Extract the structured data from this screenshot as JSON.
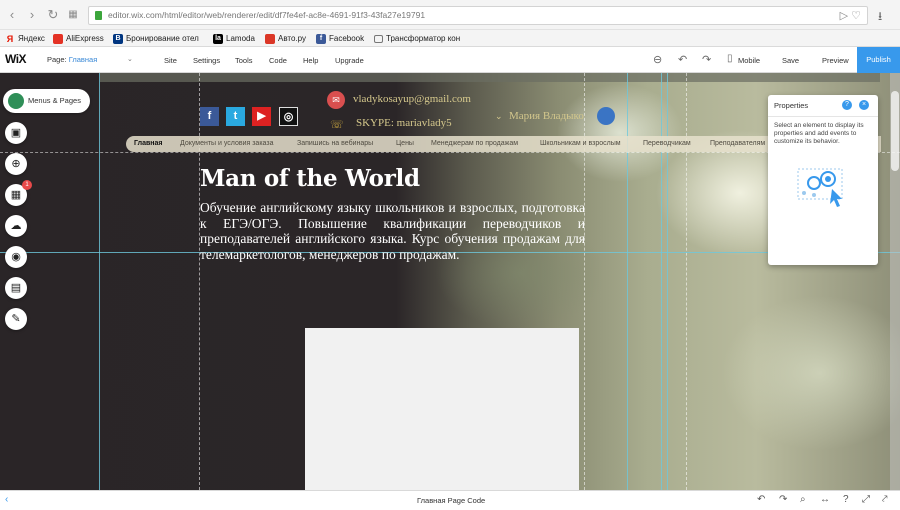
{
  "browser": {
    "url": "editor.wix.com/html/editor/web/renderer/edit/df7fe4ef-ac8e-4691-91f3-43fa27e19791",
    "bookmarks": [
      {
        "label": "Яндекс",
        "icon": "yandex-icon",
        "color": "#e61400"
      },
      {
        "label": "AliExpress",
        "icon": "aliexpress-icon",
        "color": "#e43225"
      },
      {
        "label": "Бронирование отел",
        "icon": "booking-icon",
        "color": "#003580"
      },
      {
        "label": "Lamoda",
        "icon": "lamoda-icon",
        "color": "#000000"
      },
      {
        "label": "Авто.ру",
        "icon": "autoru-icon",
        "color": "#db3727"
      },
      {
        "label": "Facebook",
        "icon": "facebook-icon",
        "color": "#3b5998"
      },
      {
        "label": "Трансформатор кон",
        "icon": "folder-icon",
        "color": "#777777"
      }
    ]
  },
  "wix": {
    "logo": "WiX",
    "page_label": "Page:",
    "page_value": "Главная",
    "menu": [
      "Site",
      "Settings",
      "Tools",
      "Code",
      "Help",
      "Upgrade"
    ],
    "mobile": "Mobile",
    "save": "Save",
    "preview": "Preview",
    "publish": "Publish",
    "accent": "#3899ec"
  },
  "left_tools": {
    "menus_pages": "Menus & Pages",
    "badge": "1"
  },
  "site": {
    "email": "vladykosayup@gmail.com",
    "skype": "SKYPE: mariavlady5",
    "login_name": "Мария Владыко",
    "nav": [
      "Главная",
      "Документы и условия заказа",
      "Запишись на вебинары",
      "Цены",
      "Менеджерам по продажам",
      "Школьникам и взрослым",
      "Переводчикам",
      "Преподавателям"
    ],
    "title": "Man of the World",
    "description": "Обучение английскому языку школьников и взрослых, подготовка к ЕГЭ/ОГЭ. Повышение квалификации переводчиков и преподавателей английского языка. Курс обучения продажам для телемаркетологов, менеджеров по продажам."
  },
  "properties": {
    "title": "Properties",
    "help": "?",
    "text": "Select an element to display its properties and add events to customize its behavior."
  },
  "bottom": {
    "label": "Главная Page Code"
  }
}
